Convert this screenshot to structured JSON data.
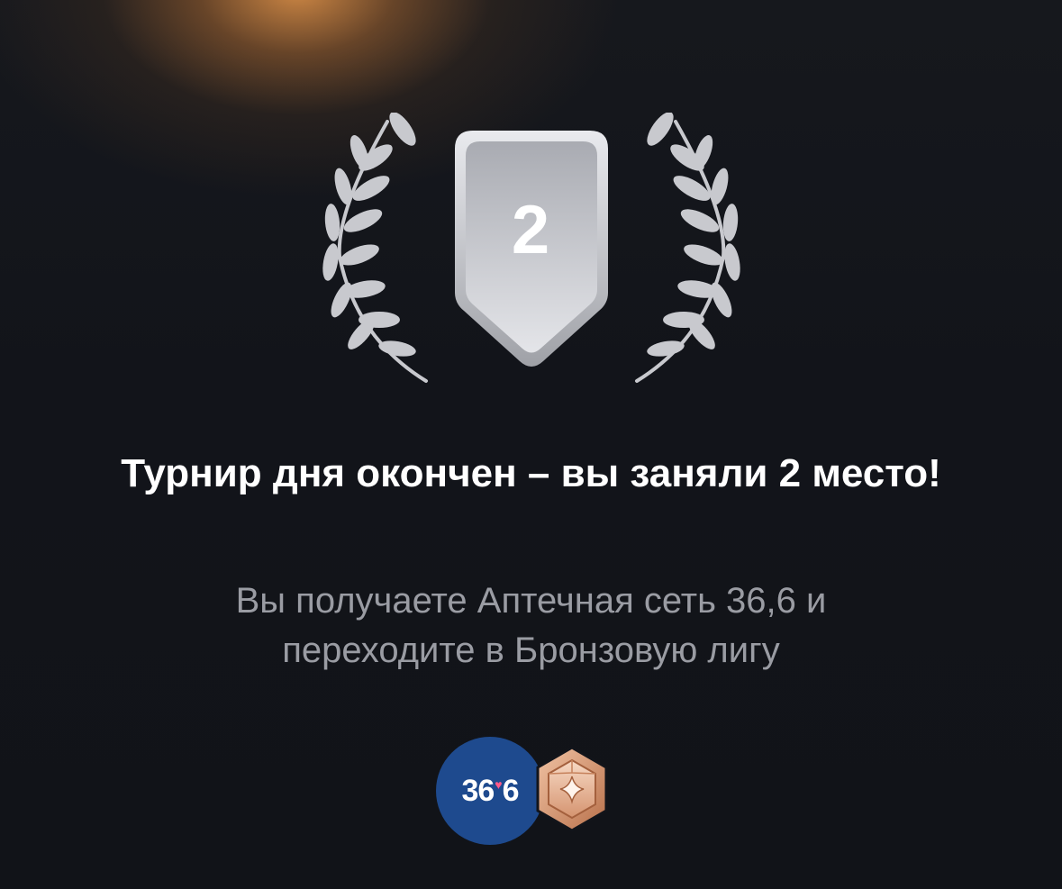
{
  "result": {
    "place": "2",
    "title": "Турнир дня окончен – вы заняли 2 место!",
    "subtitle": "Вы получаете Аптечная сеть 36,6 и переходите в Бронзовую лигу"
  },
  "rewards": {
    "partner_logo_text_left": "36",
    "partner_logo_text_right": "6",
    "partner_logo_color": "#1e4a8e",
    "league_badge_icon": "bronze-league-icon",
    "league_color": "#d4906a"
  },
  "theme": {
    "background": "#12141a",
    "glow": "#d68c46",
    "silver": "#c8c9ce"
  }
}
